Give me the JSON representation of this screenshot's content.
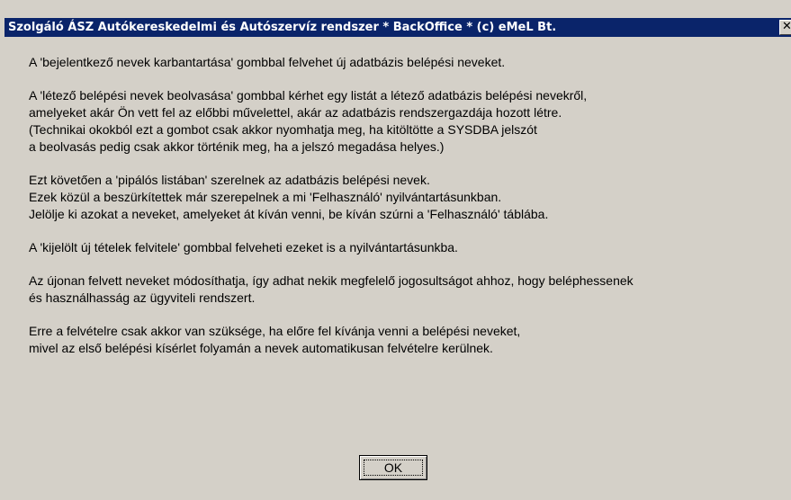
{
  "window": {
    "title": "Szolgáló ÁSZ Autókereskedelmi és Autószervíz rendszer * BackOffice * (c) eMeL Bt.",
    "close_glyph": "✕"
  },
  "message": {
    "paragraphs": [
      [
        "A 'bejelentkező nevek karbantartása' gombbal felvehet új adatbázis belépési neveket."
      ],
      [
        "A 'létező belépési nevek beolvasása' gombbal kérhet egy listát a létező adatbázis belépési nevekről,",
        "amelyeket akár Ön vett fel az előbbi művelettel, akár az adatbázis rendszergazdája hozott létre.",
        "(Technikai okokból ezt a gombot csak akkor nyomhatja meg, ha kitöltötte a SYSDBA jelszót",
        "a beolvasás pedig csak akkor történik meg, ha a jelszó megadása helyes.)"
      ],
      [
        "Ezt követően a 'pipálós listában' szerelnek az adatbázis belépési nevek.",
        "Ezek közül a beszürkítettek már szerepelnek a mi 'Felhasználó' nyilvántartásunkban.",
        "Jelölje ki azokat a neveket, amelyeket át kíván venni, be kíván szúrni a 'Felhasználó' táblába."
      ],
      [
        "A 'kijelölt új tételek felvitele' gombbal felveheti ezeket is a nyilvántartásunkba."
      ],
      [
        "Az újonan felvett neveket módosíthatja, így adhat nekik megfelelő jogosultságot ahhoz, hogy beléphessenek",
        "és használhasság az ügyviteli rendszert."
      ],
      [
        "Erre a felvételre csak akkor van szüksége, ha előre fel kívánja venni a belépési neveket,",
        "mivel az első belépési kísérlet folyamán a nevek automatikusan felvételre kerülnek."
      ]
    ]
  },
  "buttons": {
    "ok_label": "OK"
  }
}
